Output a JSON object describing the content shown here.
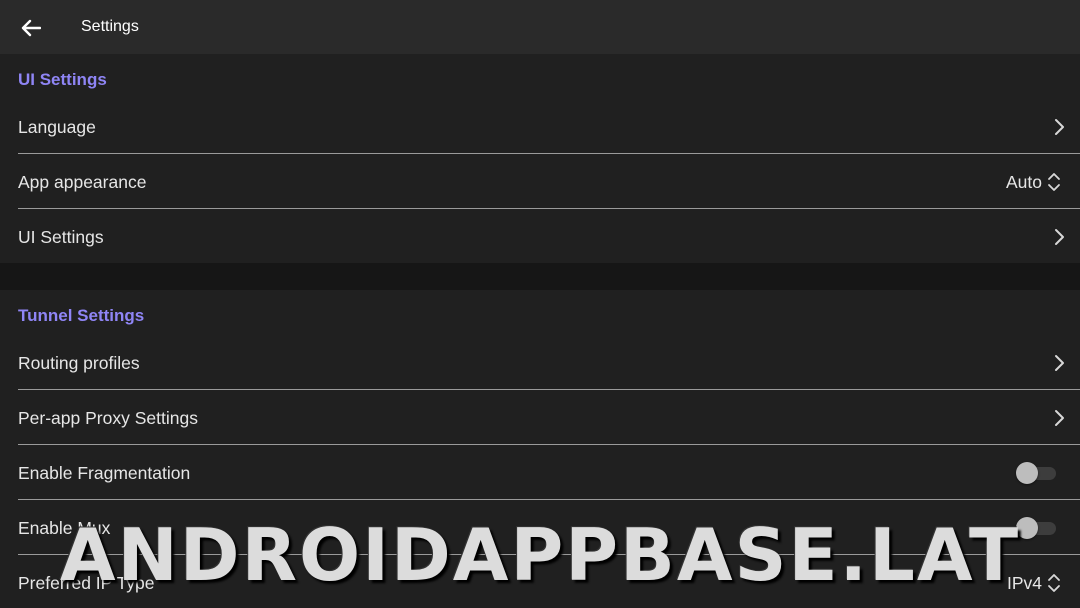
{
  "header": {
    "title": "Settings",
    "back_icon": "arrow-left-icon"
  },
  "ui_settings": {
    "title": "UI Settings",
    "items": [
      {
        "label": "Language",
        "control": "chevron"
      },
      {
        "label": "App appearance",
        "control": "select",
        "value": "Auto"
      },
      {
        "label": "UI Settings",
        "control": "chevron"
      }
    ]
  },
  "tunnel_settings": {
    "title": "Tunnel Settings",
    "items": [
      {
        "label": "Routing profiles",
        "control": "chevron"
      },
      {
        "label": "Per-app Proxy Settings",
        "control": "chevron"
      },
      {
        "label": "Enable Fragmentation",
        "control": "toggle",
        "enabled": false
      },
      {
        "label": "Enable Mux",
        "control": "toggle",
        "enabled": false
      },
      {
        "label": "Preferred IP Type",
        "control": "select",
        "value": "IPv4"
      }
    ]
  },
  "watermark": {
    "text": "ANDROIDAPPBASE.LAT"
  },
  "colors": {
    "accent": "#8f85f5",
    "background": "#202020",
    "topbar": "#2a2a2a",
    "gap": "#161616"
  }
}
